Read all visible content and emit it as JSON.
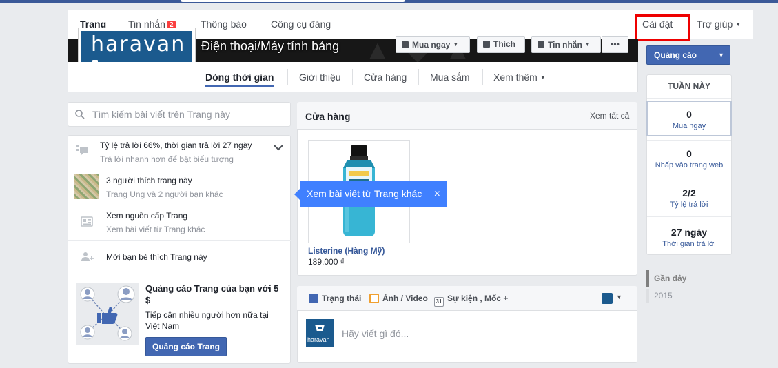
{
  "admin_nav": {
    "items": [
      {
        "label": "Trang",
        "active": true
      },
      {
        "label": "Tin nhắn",
        "badge": "2"
      },
      {
        "label": "Thông báo"
      },
      {
        "label": "Công cụ đăng"
      }
    ],
    "settings": "Cài đặt",
    "help": "Trợ giúp"
  },
  "cover": {
    "page_name": "Điện thoại/Máy tính bảng",
    "buttons": {
      "buy": "Mua ngay",
      "like": "Thích",
      "message": "Tin nhắn",
      "more": "•••"
    }
  },
  "profile": {
    "logo_text": "haravan"
  },
  "tabs": [
    {
      "label": "Dòng thời gian",
      "active": true
    },
    {
      "label": "Giới thiệu"
    },
    {
      "label": "Cửa hàng"
    },
    {
      "label": "Mua sắm"
    },
    {
      "label": "Xem thêm"
    }
  ],
  "search": {
    "placeholder": "Tìm kiếm bài viết trên Trang này"
  },
  "sidebar": {
    "response": {
      "title": "Tỷ lệ trả lời 66%, thời gian trả lời 27 ngày",
      "sub": "Trả lời nhanh hơn để bật biểu tượng"
    },
    "likes": {
      "title": "3 người thích trang này",
      "sub": "Trang Ung và 2 người bạn khác"
    },
    "feed": {
      "title": "Xem nguồn cấp Trang",
      "sub": "Xem bài viết từ Trang khác"
    },
    "invite": {
      "title": "Mời bạn bè thích Trang này"
    },
    "ad": {
      "title": "Quảng cáo Trang của bạn với 5 $",
      "sub": "Tiếp cận nhiều người hơn nữa tại Việt Nam",
      "button": "Quảng cáo Trang"
    }
  },
  "store": {
    "title": "Cửa hàng",
    "see_all": "Xem tất cả",
    "product": {
      "name": "Listerine (Hàng Mỹ)",
      "price": "189.000 ₫"
    }
  },
  "tooltip": {
    "text": "Xem bài viết từ Trang khác",
    "close": "×"
  },
  "composer": {
    "status": "Trạng thái",
    "photo": "Ảnh / Video",
    "event": "Sự kiện , Mốc +",
    "calendar_day": "31",
    "avatar_text": "haravan",
    "placeholder": "Hãy viết gì đó..."
  },
  "right": {
    "ads_button": "Quảng cáo",
    "week_title": "TUẦN NÀY",
    "stats": [
      {
        "value": "0",
        "label": "Mua ngay"
      },
      {
        "value": "0",
        "label": "Nhấp vào trang web"
      },
      {
        "value": "2/2",
        "label": "Tỷ lệ trả lời"
      },
      {
        "value": "27 ngày",
        "label": "Thời gian trả lời"
      }
    ],
    "recent": "Gần đây",
    "year": "2015"
  },
  "colors": {
    "brand": "#3b5998",
    "accent": "#4267b2",
    "tooltip": "#4080ff",
    "highlight": "#ee0000"
  }
}
